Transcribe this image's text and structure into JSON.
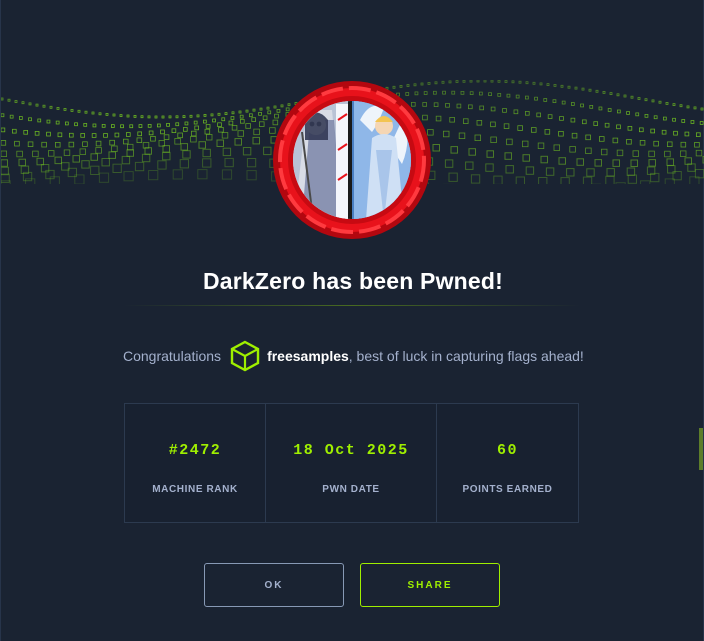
{
  "modal": {
    "title": "DarkZero has been Pwned!",
    "congrats_prefix": "Congratulations",
    "username": "freesamples",
    "congrats_suffix": ", best of luck in capturing flags ahead!"
  },
  "stats": [
    {
      "value": "#2472",
      "label": "MACHINE RANK"
    },
    {
      "value": "18 Oct 2025",
      "label": "PWN DATE"
    },
    {
      "value": "60",
      "label": "POINTS EARNED"
    }
  ],
  "buttons": {
    "ok_label": "OK",
    "share_label": "SHARE"
  },
  "colors": {
    "accent": "#9fef00",
    "background": "#1a2332",
    "badge_red": "#e8121b"
  },
  "icons": {
    "user": "hexagon-cube-icon",
    "machine": "machine-avatar-icon"
  }
}
